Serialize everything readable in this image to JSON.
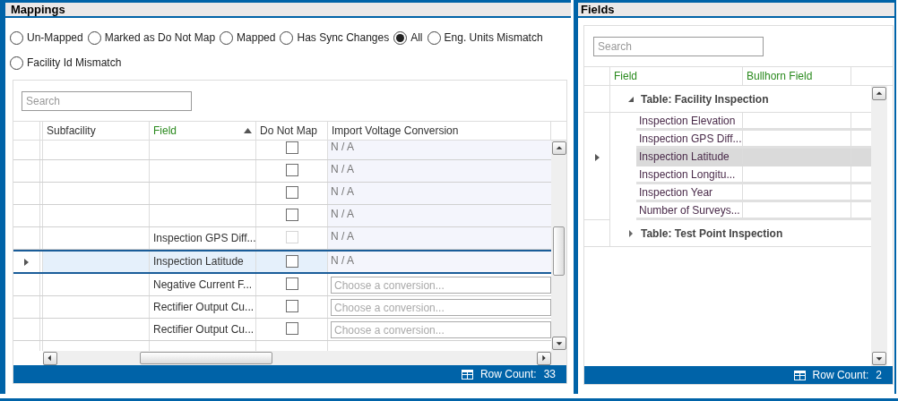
{
  "mappings": {
    "title": "Mappings",
    "filters": [
      {
        "label": "Un-Mapped",
        "selected": false
      },
      {
        "label": "Marked as Do Not Map",
        "selected": false
      },
      {
        "label": "Mapped",
        "selected": false
      },
      {
        "label": "Has Sync Changes",
        "selected": false
      },
      {
        "label": "All",
        "selected": true
      },
      {
        "label": "Eng. Units Mismatch",
        "selected": false
      },
      {
        "label": "Facility Id Mismatch",
        "selected": false
      }
    ],
    "search": {
      "placeholder": "Search"
    },
    "columns": [
      {
        "label": "Subfacility",
        "highlighted": false
      },
      {
        "label": "Field",
        "highlighted": true,
        "sorted_ascending": true
      },
      {
        "label": "Do Not Map",
        "highlighted": false
      },
      {
        "label": "Import Voltage Conversion",
        "highlighted": false
      }
    ],
    "rows": [
      {
        "do_not_map": false,
        "disabled": false,
        "selected": false,
        "kind": "na",
        "conversion": "N / A"
      },
      {
        "do_not_map": false,
        "disabled": false,
        "selected": false,
        "kind": "na",
        "conversion": "N / A"
      },
      {
        "do_not_map": false,
        "disabled": false,
        "selected": false,
        "kind": "na",
        "conversion": "N / A"
      },
      {
        "do_not_map": false,
        "disabled": false,
        "selected": false,
        "kind": "na",
        "conversion": "N / A"
      },
      {
        "field": "Inspection GPS Diff...",
        "do_not_map": false,
        "disabled": true,
        "selected": false,
        "kind": "na",
        "conversion": "N / A"
      },
      {
        "field": "Inspection Latitude",
        "do_not_map": false,
        "disabled": false,
        "selected": true,
        "kind": "na",
        "conversion": "N / A"
      },
      {
        "field": "Negative Current F...",
        "do_not_map": false,
        "disabled": false,
        "selected": false,
        "kind": "choice",
        "placeholder": "Choose a conversion..."
      },
      {
        "field": "Rectifier Output Cu...",
        "do_not_map": false,
        "disabled": false,
        "selected": false,
        "kind": "choice",
        "placeholder": "Choose a conversion..."
      },
      {
        "field": "Rectifier Output Cu...",
        "do_not_map": false,
        "disabled": false,
        "selected": false,
        "kind": "choice",
        "placeholder": "Choose a conversion..."
      }
    ],
    "status": {
      "label": "Row Count:",
      "value": "33"
    }
  },
  "fields": {
    "title": "Fields",
    "search": {
      "placeholder": "Search"
    },
    "columns": [
      {
        "label": "Field",
        "highlighted": true
      },
      {
        "label": "Bullhorn Field",
        "highlighted": true
      }
    ],
    "groups": [
      {
        "label": "Table: Facility Inspection",
        "expanded": true,
        "children": [
          {
            "label": "Inspection Elevation",
            "selected": false
          },
          {
            "label": "Inspection GPS Diff...",
            "selected": false
          },
          {
            "label": "Inspection Latitude",
            "selected": true
          },
          {
            "label": "Inspection Longitu...",
            "selected": false
          },
          {
            "label": "Inspection Year",
            "selected": false
          },
          {
            "label": "Number of Surveys...",
            "selected": false
          }
        ]
      },
      {
        "label": "Table: Test Point Inspection",
        "expanded": false
      }
    ],
    "status": {
      "label": "Row Count:",
      "value": "2"
    }
  }
}
